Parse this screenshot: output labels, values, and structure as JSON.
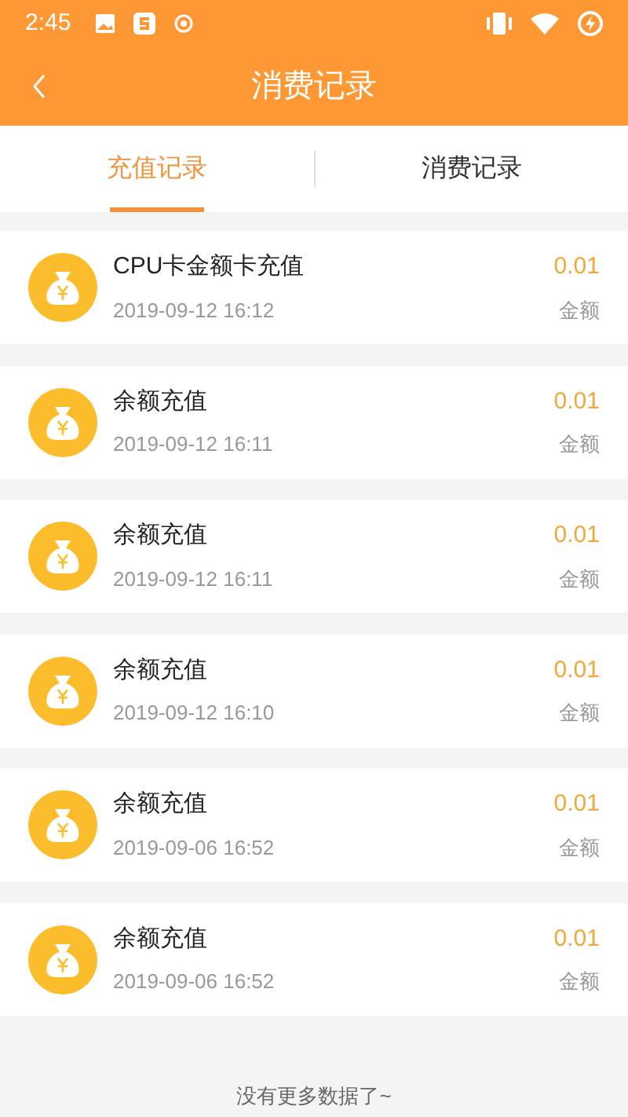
{
  "status_bar": {
    "time": "2:45"
  },
  "header": {
    "title": "消费记录"
  },
  "tabs": [
    {
      "label": "充值记录",
      "selected": true
    },
    {
      "label": "消费记录",
      "selected": false
    }
  ],
  "records": [
    {
      "title": "CPU卡金额卡充值",
      "time": "2019-09-12 16:12",
      "amount": "0.01",
      "amount_label": "金额"
    },
    {
      "title": "余额充值",
      "time": "2019-09-12 16:11",
      "amount": "0.01",
      "amount_label": "金额"
    },
    {
      "title": "余额充值",
      "time": "2019-09-12 16:11",
      "amount": "0.01",
      "amount_label": "金额"
    },
    {
      "title": "余额充值",
      "time": "2019-09-12 16:10",
      "amount": "0.01",
      "amount_label": "金额"
    },
    {
      "title": "余额充值",
      "time": "2019-09-06 16:52",
      "amount": "0.01",
      "amount_label": "金额"
    },
    {
      "title": "余额充值",
      "time": "2019-09-06 16:52",
      "amount": "0.01",
      "amount_label": "金额"
    }
  ],
  "footer": "没有更多数据了~"
}
